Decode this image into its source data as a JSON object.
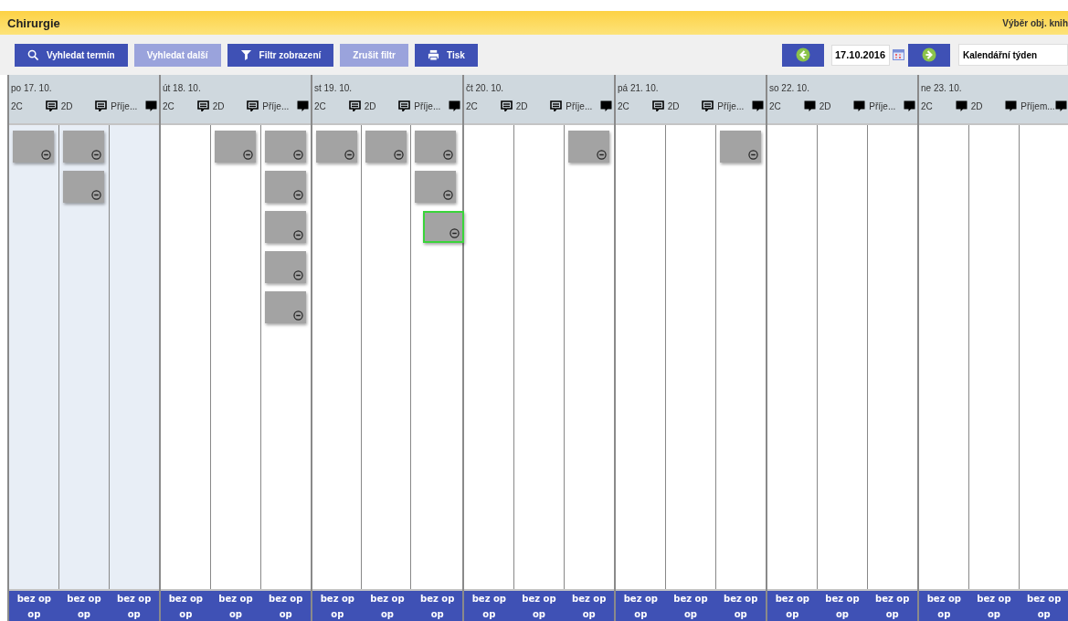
{
  "header": {
    "title": "Chirurgie",
    "right_link": "Výběr obj. knih"
  },
  "toolbar": {
    "buttons": [
      {
        "label": "Vyhledat termín",
        "kind": "search",
        "disabled": false
      },
      {
        "label": "Vyhledat další",
        "disabled": true
      },
      {
        "label": "Filtr zobrazení",
        "kind": "filter",
        "disabled": false
      },
      {
        "label": "Zrušit filtr",
        "disabled": true
      },
      {
        "label": "Tisk",
        "kind": "print",
        "disabled": false
      }
    ],
    "date": "17.10.2016",
    "view": "Kalendářní týden"
  },
  "days": [
    {
      "date": "po 17. 10.",
      "today": true,
      "columns": [
        {
          "label": "2C",
          "kind": "note",
          "cards": [
            {
              "selected": false
            }
          ],
          "footer": [
            "bez op",
            "op"
          ]
        },
        {
          "label": "2D",
          "kind": "note",
          "cards": [
            {
              "selected": false
            },
            {
              "selected": false
            }
          ],
          "footer": [
            "bez op",
            "op"
          ]
        },
        {
          "label": "Příje...",
          "kind": "bubble",
          "footer": [
            "bez op",
            "op"
          ]
        }
      ]
    },
    {
      "date": "út 18. 10.",
      "today": false,
      "columns": [
        {
          "label": "2C",
          "kind": "note",
          "footer": [
            "bez op",
            "op"
          ]
        },
        {
          "label": "2D",
          "kind": "note",
          "cards": [
            {
              "selected": false
            }
          ],
          "footer": [
            "bez op",
            "op"
          ]
        },
        {
          "label": "Příje...",
          "kind": "bubble",
          "cards": [
            {
              "selected": false
            },
            {
              "selected": false
            },
            {
              "selected": false
            },
            {
              "selected": false
            },
            {
              "selected": false
            }
          ],
          "footer": [
            "bez op",
            "op"
          ]
        }
      ]
    },
    {
      "date": "st 19. 10.",
      "today": false,
      "columns": [
        {
          "label": "2C",
          "kind": "note",
          "cards": [
            {
              "selected": false
            }
          ],
          "footer": [
            "bez op",
            "op"
          ]
        },
        {
          "label": "2D",
          "kind": "note",
          "cards": [
            {
              "selected": false
            }
          ],
          "footer": [
            "bez op",
            "op"
          ]
        },
        {
          "label": "Příje...",
          "kind": "bubble",
          "cards": [
            {
              "selected": false
            },
            {
              "selected": false
            },
            {
              "selected": true
            }
          ],
          "footer": [
            "bez op",
            "op"
          ]
        }
      ]
    },
    {
      "date": "čt 20. 10.",
      "today": false,
      "columns": [
        {
          "label": "2C",
          "kind": "note",
          "footer": [
            "bez op",
            "op"
          ]
        },
        {
          "label": "2D",
          "kind": "note",
          "footer": [
            "bez op",
            "op"
          ]
        },
        {
          "label": "Příje...",
          "kind": "bubble",
          "cards": [
            {
              "selected": false
            }
          ],
          "footer": [
            "bez op",
            "op"
          ]
        }
      ]
    },
    {
      "date": "pá 21. 10.",
      "today": false,
      "columns": [
        {
          "label": "2C",
          "kind": "note",
          "footer": [
            "bez op",
            "op"
          ]
        },
        {
          "label": "2D",
          "kind": "note",
          "footer": [
            "bez op",
            "op"
          ]
        },
        {
          "label": "Příje...",
          "kind": "bubble",
          "cards": [
            {
              "selected": false
            }
          ],
          "footer": [
            "bez op",
            "op"
          ]
        }
      ]
    },
    {
      "date": "so 22. 10.",
      "today": false,
      "columns": [
        {
          "label": "2C",
          "kind": "bubble",
          "footer": [
            "bez op",
            "op"
          ]
        },
        {
          "label": "2D",
          "kind": "bubble",
          "footer": [
            "bez op",
            "op"
          ]
        },
        {
          "label": "Příje...",
          "kind": "bubble",
          "footer": [
            "bez op",
            "op"
          ]
        }
      ]
    },
    {
      "date": "ne 23. 10.",
      "today": false,
      "columns": [
        {
          "label": "2C",
          "kind": "bubble",
          "footer": [
            "bez op",
            "op"
          ]
        },
        {
          "label": "2D",
          "kind": "bubble",
          "footer": [
            "bez op",
            "op"
          ]
        },
        {
          "label": "Příjem...",
          "kind": "bubble",
          "footer": [
            "bez op",
            "op"
          ]
        }
      ]
    }
  ]
}
